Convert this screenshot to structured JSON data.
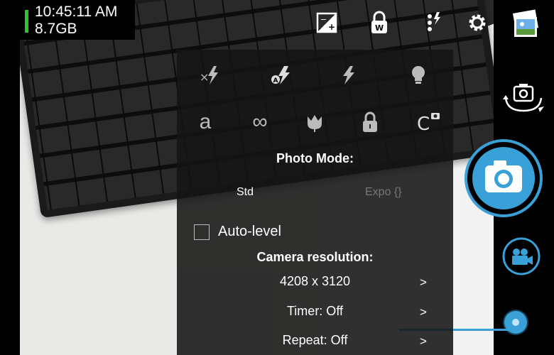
{
  "status": {
    "time": "10:45:11 AM",
    "storage": "8.7GB"
  },
  "top_icons": [
    "exposure-icon",
    "white-balance-lock-icon",
    "more-icon",
    "settings-icon",
    "gallery-icon"
  ],
  "right_panel": [
    "switch-camera-icon",
    "shutter-camera-icon",
    "video-camera-icon"
  ],
  "popup": {
    "flash_icons": [
      "flash-off-icon",
      "flash-auto-icon",
      "flash-on-icon",
      "torch-icon"
    ],
    "focus_icons": [
      "focus-auto-icon",
      "focus-infinity-icon",
      "focus-macro-icon",
      "focus-lock-icon",
      "focus-continuous-icon"
    ],
    "photo_mode_title": "Photo Mode:",
    "photo_modes": [
      "Std",
      "Expo {}"
    ],
    "auto_level_label": "Auto-level",
    "camera_resolution_title": "Camera resolution:",
    "resolution_value": "4208 x 3120",
    "timer_label": "Timer: Off",
    "repeat_label": "Repeat: Off",
    "arrow": ">"
  },
  "colors": {
    "accent": "#3aa0d8",
    "battery": "#2cc62c",
    "popup_bg": "#141414"
  }
}
